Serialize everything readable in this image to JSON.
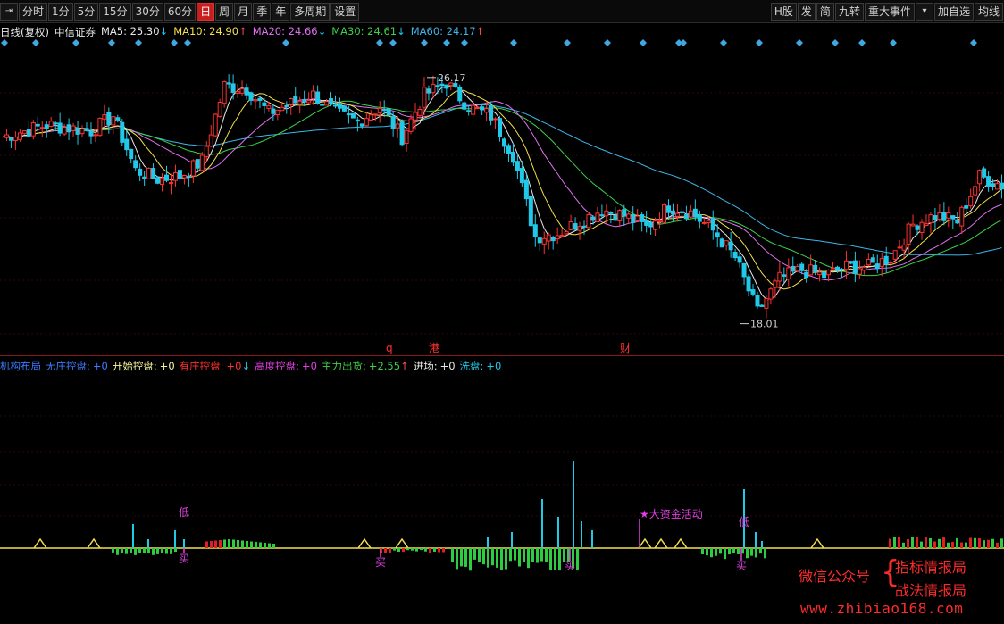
{
  "toolbar": {
    "left": [
      {
        "id": "pin",
        "label": "⇥",
        "icon": "pin-icon"
      },
      {
        "id": "fenshi",
        "label": "分时"
      },
      {
        "id": "m1",
        "label": "1分"
      },
      {
        "id": "m5",
        "label": "5分"
      },
      {
        "id": "m15",
        "label": "15分"
      },
      {
        "id": "m30",
        "label": "30分"
      },
      {
        "id": "m60",
        "label": "60分"
      },
      {
        "id": "day",
        "label": "日",
        "active": true
      },
      {
        "id": "week",
        "label": "周"
      },
      {
        "id": "month",
        "label": "月"
      },
      {
        "id": "season",
        "label": "季"
      },
      {
        "id": "year",
        "label": "年"
      },
      {
        "id": "multi",
        "label": "多周期"
      },
      {
        "id": "settings",
        "label": "设置"
      }
    ],
    "right": [
      {
        "id": "hshare",
        "label": "H股"
      },
      {
        "id": "fa",
        "label": "发"
      },
      {
        "id": "jian",
        "label": "简"
      },
      {
        "id": "jiuzhuan",
        "label": "九转"
      },
      {
        "id": "events",
        "label": "重大事件"
      },
      {
        "id": "dropdown",
        "label": "▾",
        "icon": "chevron-down-icon"
      },
      {
        "id": "addfav",
        "label": "加自选"
      },
      {
        "id": "junxian",
        "label": "均线"
      }
    ]
  },
  "ma_header": {
    "period": "日线(复权)",
    "stock": "中信证券",
    "items": [
      {
        "label": "MA5: 25.30",
        "arrow": "↓",
        "dir": "down",
        "color": "#e8e8e8"
      },
      {
        "label": "MA10: 24.90",
        "arrow": "↑",
        "dir": "up",
        "color": "#f4e04d"
      },
      {
        "label": "MA20: 24.66",
        "arrow": "↓",
        "dir": "down",
        "color": "#e070f0"
      },
      {
        "label": "MA30: 24.61",
        "arrow": "↓",
        "dir": "down",
        "color": "#3ed04a"
      },
      {
        "label": "MA60: 24.17",
        "arrow": "↑",
        "dir": "up",
        "color": "#3fb5e8"
      }
    ]
  },
  "price_chart": {
    "high_label": "26.17",
    "low_label": "18.01",
    "markers": [
      {
        "text": "q",
        "color": "#ff3030"
      },
      {
        "text": "港",
        "color": "#ff3030"
      },
      {
        "text": "财",
        "color": "#ff3030"
      }
    ]
  },
  "indicator_header": {
    "title": "机构布局",
    "items": [
      {
        "label": "无庄控盘:",
        "value": "+0",
        "color": "#3a7bff"
      },
      {
        "label": "开始控盘:",
        "value": "+0",
        "color": "#f4f4a0"
      },
      {
        "label": "有庄控盘:",
        "value": "+0",
        "color": "#ff3030",
        "arrow": "↓"
      },
      {
        "label": "高度控盘:",
        "value": "+0",
        "color": "#e040e0"
      },
      {
        "label": "主力出货:",
        "value": "+2.55",
        "color": "#3ed04a",
        "arrow": "↑"
      },
      {
        "label": "进场:",
        "value": "+0",
        "color": "#e8e8e8"
      },
      {
        "label": "洗盘:",
        "value": "+0",
        "color": "#21c9e8"
      }
    ]
  },
  "indicator_chart": {
    "labels": {
      "di": "低",
      "mai": "买",
      "fund": "★大资金活动"
    }
  },
  "watermark": {
    "channel": "微信公众号",
    "brace": "{",
    "name1": "指标情报局",
    "name2": "战法情报局",
    "url": "www.zhibiao168.com"
  },
  "colors": {
    "up": "#ff3030",
    "down": "#21c9e8",
    "accent": "#c81e1e",
    "watermark": "#ff2b2b"
  }
}
